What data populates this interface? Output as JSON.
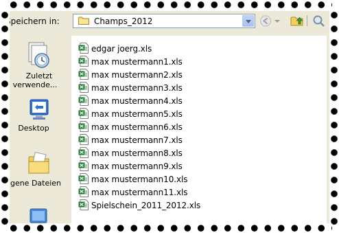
{
  "toolbar": {
    "save_in_label": "Speichern in:",
    "folder_name": "Champs_2012"
  },
  "places": [
    {
      "label_line1": "Zuletzt",
      "label_line2": "verwende...",
      "icon": "recent-documents-icon"
    },
    {
      "label_line1": "Desktop",
      "label_line2": "",
      "icon": "desktop-icon"
    },
    {
      "label_line1": "Eigene Dateien",
      "label_line2": "",
      "icon": "my-documents-icon"
    },
    {
      "label_line1": "",
      "label_line2": "",
      "icon": "my-computer-icon"
    }
  ],
  "files": [
    "edgar joerg.xls",
    "max mustermann1.xls",
    "max mustermann2.xls",
    "max mustermann3.xls",
    "max mustermann4.xls",
    "max mustermann5.xls",
    "max mustermann6.xls",
    "max mustermann7.xls",
    "max mustermann8.xls",
    "max mustermann9.xls",
    "max mustermann10.xls",
    "max mustermann11.xls",
    "Spielschein_2011_2012.xls"
  ],
  "colors": {
    "dialog_bg": "#ece9d8",
    "combo_border": "#7f9db9",
    "excel_green": "#1e7b34"
  }
}
